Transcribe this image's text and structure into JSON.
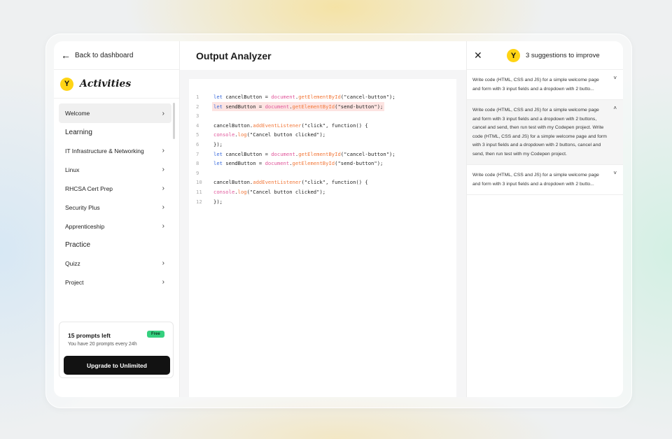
{
  "sidebar": {
    "back_label": "Back to dashboard",
    "brand": "Activities",
    "logo_letter": "Y",
    "items": [
      {
        "type": "item",
        "label": "Welcome",
        "active": true
      },
      {
        "type": "section",
        "label": "Learning"
      },
      {
        "type": "item",
        "label": "IT Infrastructure & Networking"
      },
      {
        "type": "item",
        "label": "Linux"
      },
      {
        "type": "item",
        "label": "RHCSA Cert Prep"
      },
      {
        "type": "item",
        "label": "Security Plus"
      },
      {
        "type": "item",
        "label": "Apprenticeship"
      },
      {
        "type": "section",
        "label": "Practice"
      },
      {
        "type": "item",
        "label": "Quizz"
      },
      {
        "type": "item",
        "label": "Project"
      }
    ],
    "prompts": {
      "title": "15 prompts left",
      "subtitle": "You have 20 prompts every 24h",
      "badge": "Free",
      "upgrade_label": "Upgrade to Unlimited"
    }
  },
  "main": {
    "title": "Output Analyzer",
    "code": [
      {
        "n": "1",
        "text": "let cancelButton = document.getElementById(\"cancel-button\");"
      },
      {
        "n": "2",
        "text": "let sendButton = document.getElementById(\"send-button\");",
        "highlight": true
      },
      {
        "n": "3",
        "text": ""
      },
      {
        "n": "4",
        "text": "cancelButton.addEventListener(\"click\", function() {"
      },
      {
        "n": "5",
        "text": "console.log(\"Cancel button clicked\");"
      },
      {
        "n": "6",
        "text": "});"
      },
      {
        "n": "7",
        "text": "let cancelButton = document.getElementById(\"cancel-button\");"
      },
      {
        "n": "8",
        "text": "let sendButton = document.getElementById(\"send-button\");"
      },
      {
        "n": "9",
        "text": ""
      },
      {
        "n": "10",
        "text": "cancelButton.addEventListener(\"click\", function() {"
      },
      {
        "n": "11",
        "text": "console.log(\"Cancel button clicked\");"
      },
      {
        "n": "12",
        "text": "});"
      }
    ]
  },
  "suggestions": {
    "title": "3 suggestions to improve",
    "logo_letter": "Y",
    "items": [
      {
        "text": "Write code (HTML, CSS and JS) for a simple welcome page and form with 3 input fields and a dropdown with 2 butto...",
        "expanded": false
      },
      {
        "text": "Write code (HTML, CSS and JS) for a simple welcome page and form with 3 input fields and a dropdown with 2 buttons, cancel and send, then run test with my Codepen project. Write code (HTML, CSS and JS) for a simple welcome page and form with 3 input fields and a dropdown with 2 buttons, cancel and send, then run test with my Codepen project.",
        "expanded": true
      },
      {
        "text": "Write code (HTML, CSS and JS) for a simple welcome page and form with 3 input fields and a dropdown with 2 butto...",
        "expanded": false
      }
    ]
  },
  "colors": {
    "accent_yellow": "#ffd414",
    "badge_green": "#35d07f",
    "highlight_line": "#fde4e2",
    "keyword": "#3b6bdc",
    "object": "#e0569a",
    "method": "#f2783a"
  }
}
